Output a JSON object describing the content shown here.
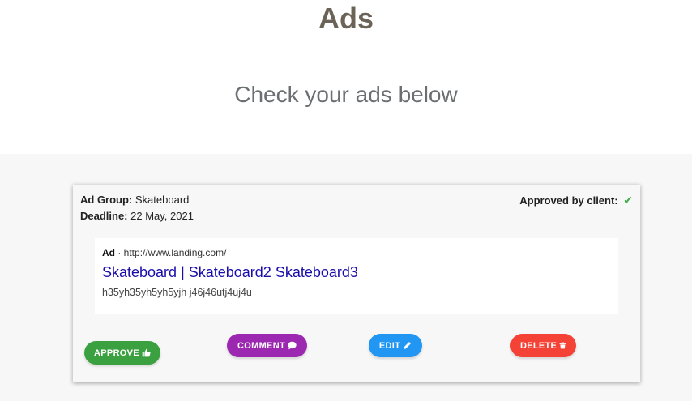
{
  "header": {
    "title": "Ads",
    "subtitle": "Check your ads below"
  },
  "ad_card": {
    "ad_group_label": "Ad Group:",
    "ad_group_value": "Skateboard",
    "deadline_label": "Deadline:",
    "deadline_value": "22 May, 2021",
    "approval_label": "Approved by client:",
    "approval_icon": "check-icon",
    "approval_color": "#3cae49",
    "preview": {
      "ad_label": "Ad",
      "separator": " · ",
      "url": "http://www.landing.com/",
      "headline": "Skateboard | Skateboard2 Skateboard3",
      "description": "h35yh35yh5yh5yjh j46j46utj4uj4u"
    },
    "buttons": {
      "approve": {
        "label": "APPROVE",
        "icon": "thumbs-up-icon",
        "color": "#3ba03f"
      },
      "comment": {
        "label": "COMMENT",
        "icon": "comment-icon",
        "color": "#9c27b0"
      },
      "edit": {
        "label": "EDIT",
        "icon": "pencil-icon",
        "color": "#2196f3"
      },
      "delete": {
        "label": "DELETE",
        "icon": "trash-icon",
        "color": "#f44336"
      }
    }
  }
}
